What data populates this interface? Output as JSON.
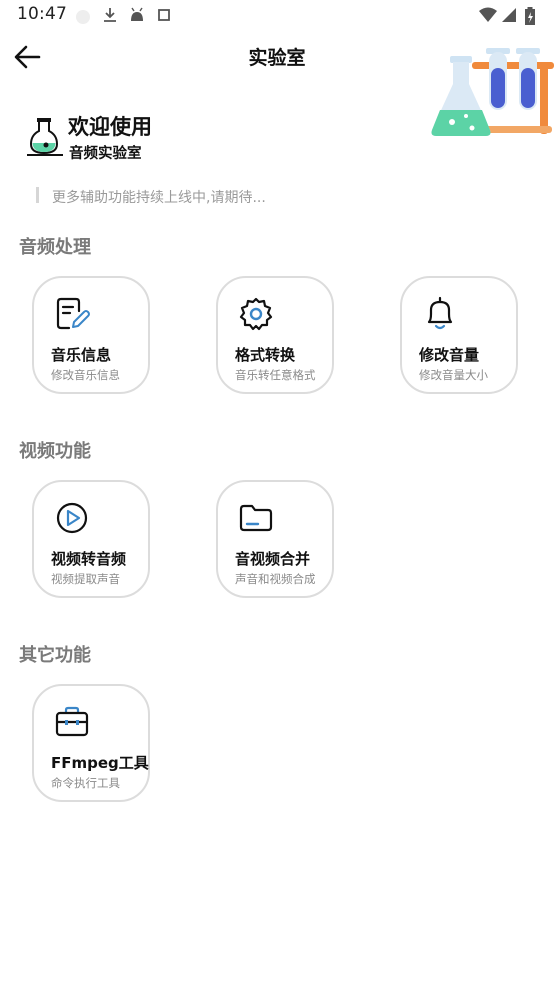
{
  "status_bar": {
    "time": "10:47",
    "icons": [
      "circle-placeholder-icon",
      "download-icon",
      "android-icon",
      "square-icon",
      "wifi-icon",
      "signal-icon",
      "battery-charging-icon"
    ]
  },
  "appbar": {
    "title": "实验室",
    "back_icon": "back-arrow-icon"
  },
  "welcome": {
    "title": "欢迎使用",
    "subtitle": "音频实验室"
  },
  "notice": {
    "text": "更多辅助功能持续上线中,请期待..."
  },
  "sections": [
    {
      "title": "音频处理",
      "cards": [
        {
          "title": "音乐信息",
          "subtitle": "修改音乐信息",
          "icon": "edit-document-icon"
        },
        {
          "title": "格式转换",
          "subtitle": "音乐转任意格式",
          "icon": "gear-icon"
        },
        {
          "title": "修改音量",
          "subtitle": "修改音量大小",
          "icon": "bell-icon"
        }
      ]
    },
    {
      "title": "视频功能",
      "cards": [
        {
          "title": "视频转音频",
          "subtitle": "视频提取声音",
          "icon": "play-circle-icon"
        },
        {
          "title": "音视频合并",
          "subtitle": "声音和视频合成",
          "icon": "folder-icon"
        }
      ]
    },
    {
      "title": "其它功能",
      "cards": [
        {
          "title": "FFmpeg工具",
          "subtitle": "命令执行工具",
          "icon": "toolbox-icon"
        }
      ]
    }
  ],
  "colors": {
    "accent": "#3a86c8",
    "section_title": "#7a7a7a",
    "card_border": "#dcdcdc",
    "illustration_green": "#5cd3a6",
    "illustration_orange": "#f08a3c",
    "illustration_blue": "#4a5fd0"
  }
}
